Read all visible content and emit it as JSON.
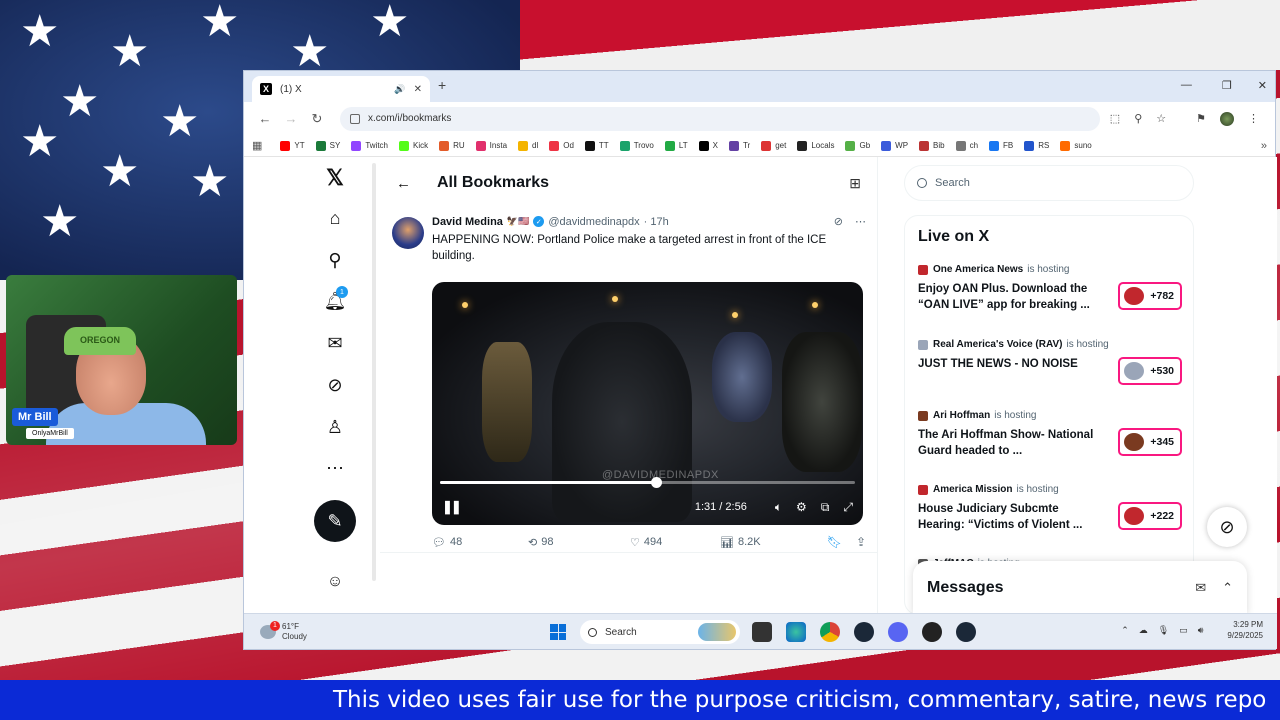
{
  "browser": {
    "tab_title": "(1) X",
    "url": "x.com/i/bookmarks",
    "bookmarks": [
      {
        "label": "YT",
        "color": "#ff0000"
      },
      {
        "label": "SY",
        "color": "#1b7a3a"
      },
      {
        "label": "Twitch",
        "color": "#9146ff"
      },
      {
        "label": "Kick",
        "color": "#53fc18"
      },
      {
        "label": "RU",
        "color": "#e35b29"
      },
      {
        "label": "Insta",
        "color": "#e1306c"
      },
      {
        "label": "dl",
        "color": "#f4b400"
      },
      {
        "label": "Od",
        "color": "#e34"
      },
      {
        "label": "TT",
        "color": "#111111"
      },
      {
        "label": "Trovo",
        "color": "#1aa36b"
      },
      {
        "label": "LT",
        "color": "#22aa44"
      },
      {
        "label": "X",
        "color": "#000000"
      },
      {
        "label": "Tr",
        "color": "#6441a4"
      },
      {
        "label": "get",
        "color": "#d33"
      },
      {
        "label": "Locals",
        "color": "#222222"
      },
      {
        "label": "Gb",
        "color": "#55b047"
      },
      {
        "label": "WP",
        "color": "#3b5bdb"
      },
      {
        "label": "Bib",
        "color": "#b33"
      },
      {
        "label": "ch",
        "color": "#777777"
      },
      {
        "label": "FB",
        "color": "#1877f2"
      },
      {
        "label": "RS",
        "color": "#2255cc"
      },
      {
        "label": "suno",
        "color": "#ff6a00"
      }
    ]
  },
  "page": {
    "title": "All Bookmarks",
    "tweet": {
      "name": "David Medina",
      "emoji": "🦅🇺🇸",
      "handle": "@davidmedinapdx",
      "time": "· 17h",
      "text": "HAPPENING NOW: Portland Police make a targeted arrest in front of the ICE building.",
      "video": {
        "watermark": "@DAVIDMEDINAPDX",
        "time": "1:31 / 2:56",
        "progress": 0.52
      },
      "stats": {
        "replies": "48",
        "reposts": "98",
        "likes": "494",
        "views": "8.2K"
      }
    }
  },
  "sidebar": {
    "search_placeholder": "Search",
    "live_title": "Live on X",
    "live_items": [
      {
        "host": "One America News",
        "hosting": "is hosting",
        "title": "Enjoy OAN Plus. Download the “OAN LIVE” app for breaking ...",
        "count": "+782",
        "icon_color": "#c1272d"
      },
      {
        "host": "Real America's Voice (RAV)",
        "hosting": "is hosting",
        "title": "JUST THE NEWS - NO NOISE",
        "count": "+530",
        "icon_color": "#9aa5b8"
      },
      {
        "host": "Ari Hoffman",
        "hosting": "is hosting",
        "title": "The Ari Hoffman Show- National Guard headed to ...",
        "count": "+345",
        "icon_color": "#7a3a20"
      },
      {
        "host": "America Mission",
        "hosting": "is hosting",
        "title": "House Judiciary Subcmte Hearing: “Victims of Violent ...",
        "count": "+222",
        "icon_color": "#c1272d"
      },
      {
        "host": "JeffMAC",
        "hosting": "is hosting",
        "title": "",
        "count": "",
        "icon_color": "#555555"
      }
    ],
    "messages_title": "Messages"
  },
  "taskbar": {
    "temp": "61°F",
    "weather": "Cloudy",
    "search_label": "Search",
    "time": "3:29 PM",
    "date": "9/29/2025",
    "notification_count": "1"
  },
  "webcam": {
    "cap_text": "OREGON",
    "name": "Mr Bill",
    "handle": "OnlyaMrBill"
  },
  "banner": {
    "text": "This video uses fair use for the purpose criticism, commentary, satire, news repo"
  },
  "colors": {
    "accent": "#1d9bf0",
    "live_border": "#f91880",
    "banner_bg": "#0b2ad6"
  }
}
